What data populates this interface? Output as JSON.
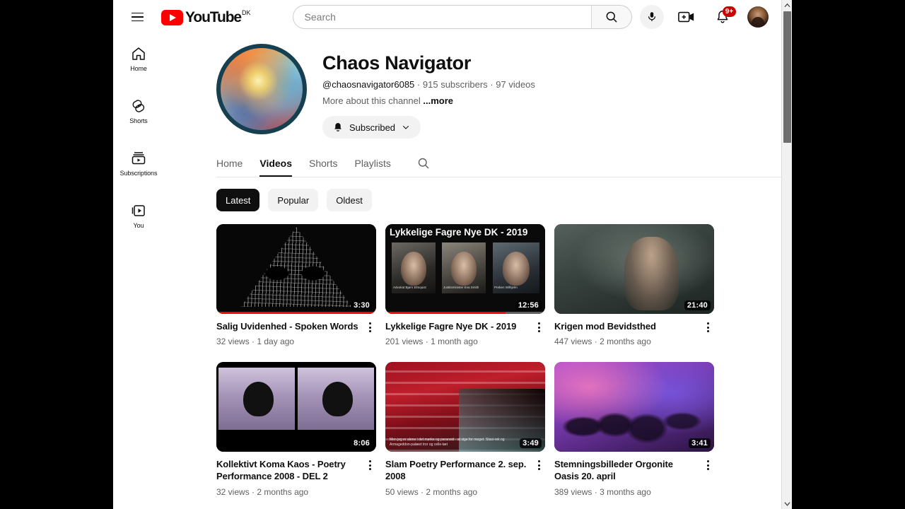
{
  "masthead": {
    "menu_icon": "hamburger-icon",
    "logo_text": "YouTube",
    "logo_country": "DK",
    "search_placeholder": "Search",
    "search_value": "",
    "search_icon": "search-icon",
    "mic_icon": "microphone-icon",
    "create_icon": "create-video-icon",
    "notifications_icon": "bell-icon",
    "notifications_badge": "9+",
    "avatar_icon": "account-avatar"
  },
  "sidebar": {
    "items": [
      {
        "label": "Home",
        "icon": "home-icon"
      },
      {
        "label": "Shorts",
        "icon": "shorts-icon"
      },
      {
        "label": "Subscriptions",
        "icon": "subscriptions-icon"
      },
      {
        "label": "You",
        "icon": "you-icon"
      }
    ]
  },
  "channel": {
    "name": "Chaos Navigator",
    "handle": "@chaosnavigator6085",
    "subscribers": "915 subscribers",
    "videos_count": "97 videos",
    "separator": "·",
    "description": "More about this channel",
    "description_more": "...more",
    "subscribe_label": "Subscribed",
    "subscribe_bell_icon": "bell-icon",
    "subscribe_chevron_icon": "chevron-down-icon",
    "avatar_icon": "channel-avatar"
  },
  "tabs": [
    {
      "label": "Home",
      "active": false
    },
    {
      "label": "Videos",
      "active": true
    },
    {
      "label": "Shorts",
      "active": false
    },
    {
      "label": "Playlists",
      "active": false
    }
  ],
  "tab_search_icon": "search-icon",
  "chips": [
    {
      "label": "Latest",
      "active": true
    },
    {
      "label": "Popular",
      "active": false
    },
    {
      "label": "Oldest",
      "active": false
    }
  ],
  "videos": [
    {
      "title": "Salig Uvidenhed - Spoken Words",
      "views": "32 views",
      "age": "1 day ago",
      "duration": "3:30",
      "progress_percent": 100,
      "overlay_title": "",
      "menu_icon": "kebab-menu-icon"
    },
    {
      "title": "Lykkelige Fagre Nye DK - 2019",
      "views": "201 views",
      "age": "1 month ago",
      "duration": "12:56",
      "progress_percent": 75,
      "overlay_title": "Lykkelige Fagre Nye DK - 2019",
      "caption_1": "Advokat Bjørn Elmquist",
      "caption_2": "Justitsminister Eva Smith",
      "caption_3": "Preben Wilhjelm",
      "menu_icon": "kebab-menu-icon"
    },
    {
      "title": "Krigen mod Bevidsthed",
      "views": "447 views",
      "age": "2 months ago",
      "duration": "21:40",
      "progress_percent": 0,
      "overlay_title": "",
      "menu_icon": "kebab-menu-icon"
    },
    {
      "title": "Kollektivt Koma Kaos - Poetry Performance 2008 - DEL 2",
      "views": "32 views",
      "age": "2 months ago",
      "duration": "8:06",
      "progress_percent": 0,
      "overlay_title": "",
      "menu_icon": "kebab-menu-icon"
    },
    {
      "title": "Slam Poetry Performance 2. sep. 2008",
      "views": "50 views",
      "age": "2 months ago",
      "duration": "3:49",
      "progress_percent": 0,
      "overlay_title": "",
      "caption": "Men jeg er alene i det mørke og paranoid - at sige for meget. Stasi-rek og Armageddon-palæet tror og celle-tæt",
      "menu_icon": "kebab-menu-icon"
    },
    {
      "title": "Stemningsbilleder Orgonite Oasis 20. april",
      "views": "389 views",
      "age": "3 months ago",
      "duration": "3:41",
      "progress_percent": 0,
      "overlay_title": "",
      "menu_icon": "kebab-menu-icon"
    }
  ],
  "scrollbar": {
    "up_icon": "chevron-up-icon",
    "down_icon": "chevron-down-icon"
  },
  "colors": {
    "brand_red": "#ff0000",
    "badge_red": "#cc0000",
    "text_primary": "#0f0f0f",
    "text_secondary": "#606060",
    "chip_bg": "#f2f2f2",
    "chip_active_bg": "#0f0f0f"
  }
}
